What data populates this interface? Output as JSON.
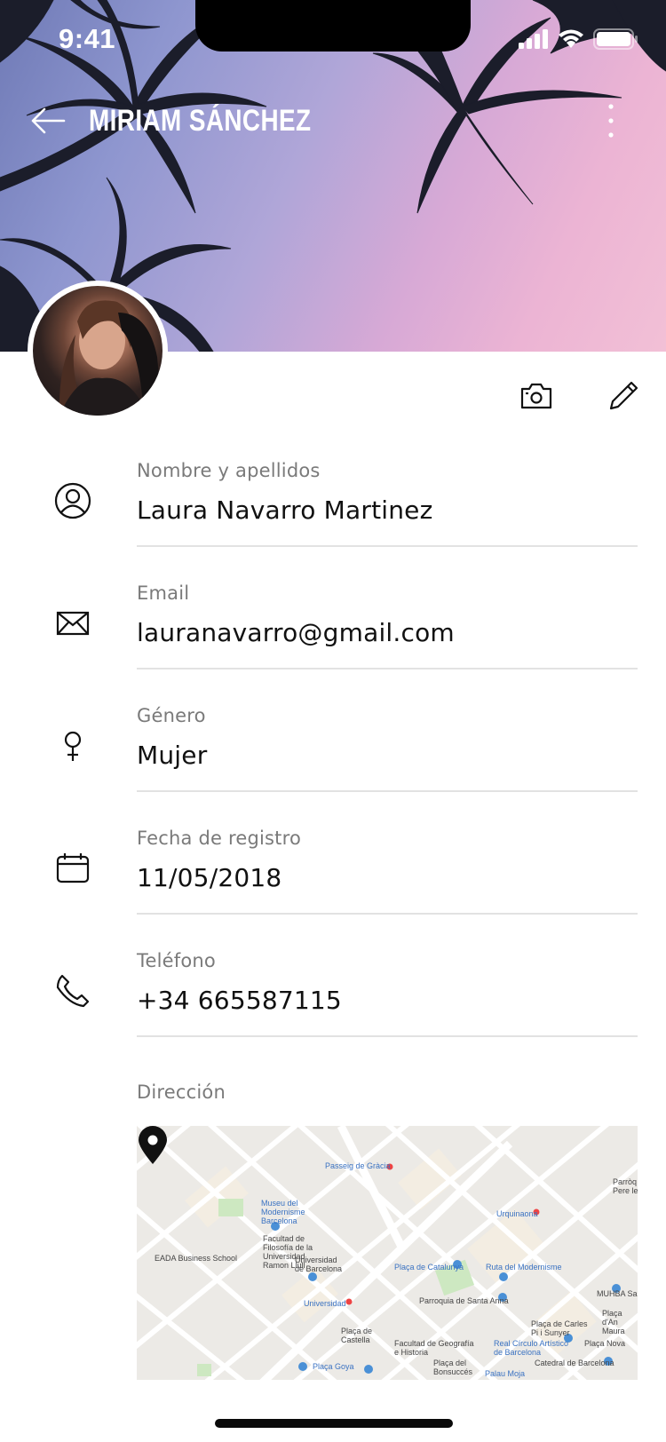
{
  "status_bar": {
    "time": "9:41"
  },
  "app_bar": {
    "title": "MIRIAM SÁNCHEZ"
  },
  "fields": [
    {
      "label": "Nombre y apellidos",
      "value": "Laura Navarro Martinez",
      "icon": "user-circle-icon"
    },
    {
      "label": "Email",
      "value": "lauranavarro@gmail.com",
      "icon": "envelope-icon"
    },
    {
      "label": "Género",
      "value": "Mujer",
      "icon": "female-icon"
    },
    {
      "label": "Fecha de registro",
      "value": "11/05/2018",
      "icon": "calendar-icon"
    },
    {
      "label": "Teléfono",
      "value": "+34 665587115",
      "icon": "phone-icon"
    }
  ],
  "address": {
    "label": "Dirección",
    "map_labels": [
      "Passeig de Gràcia",
      "Museu del Modernisme Barcelona",
      "Facultad de Filosofía de la Universidad Ramon Llull",
      "EADA Business School",
      "Universidad de Barcelona",
      "Universidad",
      "Plaça de Catalunya",
      "Ruta del Modernisme",
      "Urquinaona",
      "Parroquia de Santa Anna",
      "MUHBA Sa",
      "Plaça de Castella",
      "Facultad de Geografía e Historia",
      "Real Círculo Artístico de Barcelona",
      "Plaça de Carles Pi i Sunyer",
      "Plaça Nova",
      "Catedral de Barcelona",
      "Plaça Goya",
      "Plaça del Bonsuccés",
      "Palau Moja",
      "Parròq Pere le",
      "Plaça d'An Maura"
    ]
  },
  "colors": {
    "label_gray": "#7a7a7a",
    "divider": "#e2e2e2",
    "text": "#111111"
  }
}
